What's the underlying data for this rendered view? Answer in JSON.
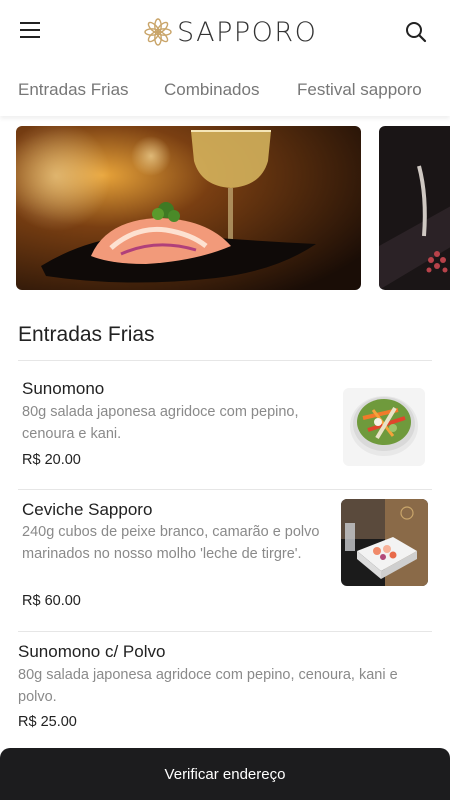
{
  "header": {
    "brand": "SAPPORO",
    "menu_icon": "hamburger-menu-icon",
    "search_icon": "search-icon",
    "logo_icon": "lotus-flower-icon",
    "accent_color": "#c9a56a"
  },
  "tabs": [
    {
      "label": "Entradas Frias"
    },
    {
      "label": "Combinados"
    },
    {
      "label": "Festival sapporo"
    }
  ],
  "section": {
    "title": "Entradas Frias"
  },
  "items": [
    {
      "name": "Sunomono",
      "description": "80g salada japonesa agridoce com pepino, cenoura e kani.",
      "price": "R$ 20.00"
    },
    {
      "name": "Ceviche Sapporo",
      "description": "240g cubos de peixe branco, camarão e polvo marinados no nosso molho 'leche de tirgre'.",
      "price": "R$ 60.00"
    },
    {
      "name": "Sunomono c/ Polvo",
      "description": "80g salada japonesa agridoce com pepino, cenoura, kani e polvo.",
      "price": "R$ 25.00"
    }
  ],
  "bottom_bar": {
    "label": "Verificar endereço"
  }
}
